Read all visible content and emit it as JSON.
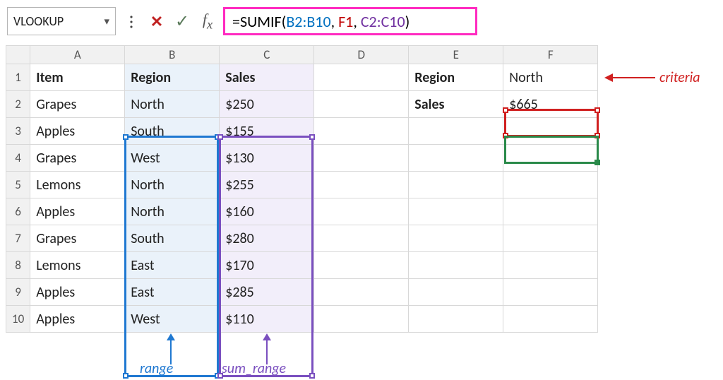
{
  "namebox": {
    "value": "VLOOKUP"
  },
  "formula": {
    "eq": "=",
    "fn": "SUMIF",
    "open": "(",
    "arg1": "B2:B10",
    "sep1": ", ",
    "arg2": "F1",
    "sep2": ", ",
    "arg3": "C2:C10",
    "close": ")"
  },
  "columns": [
    "A",
    "B",
    "C",
    "D",
    "E",
    "F"
  ],
  "row_labels": [
    "1",
    "2",
    "3",
    "4",
    "5",
    "6",
    "7",
    "8",
    "9",
    "10"
  ],
  "headers": {
    "A1": "Item",
    "B1": "Region",
    "C1": "Sales"
  },
  "side": {
    "E1": "Region",
    "E2": "Sales",
    "F1": "North",
    "F2": "$665"
  },
  "data": [
    {
      "item": "Grapes",
      "region": "North",
      "sales": "$250"
    },
    {
      "item": "Apples",
      "region": "South",
      "sales": "$155"
    },
    {
      "item": "Grapes",
      "region": "West",
      "sales": "$130"
    },
    {
      "item": "Lemons",
      "region": "North",
      "sales": "$255"
    },
    {
      "item": "Apples",
      "region": "North",
      "sales": "$160"
    },
    {
      "item": "Grapes",
      "region": "South",
      "sales": "$280"
    },
    {
      "item": "Lemons",
      "region": "East",
      "sales": "$170"
    },
    {
      "item": "Apples",
      "region": "East",
      "sales": "$285"
    },
    {
      "item": "Apples",
      "region": "West",
      "sales": "$110"
    }
  ],
  "annotations": {
    "range_label": "range",
    "sum_range_label": "sum_range",
    "criteria_label": "criteria"
  }
}
